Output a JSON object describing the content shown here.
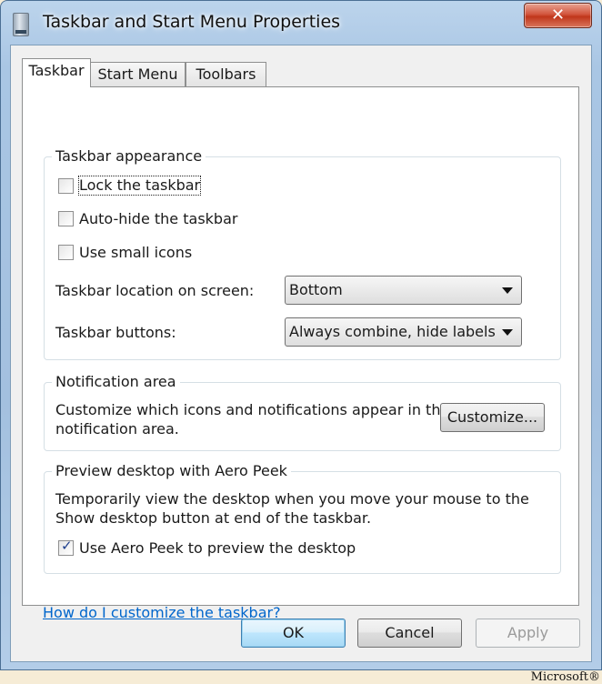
{
  "window": {
    "title": "Taskbar and Start Menu Properties",
    "close_glyph": "✕"
  },
  "tabs": [
    {
      "label": "Taskbar",
      "active": true
    },
    {
      "label": "Start Menu",
      "active": false
    },
    {
      "label": "Toolbars",
      "active": false
    }
  ],
  "taskbar_appearance": {
    "title": "Taskbar appearance",
    "lock_taskbar": {
      "label": "Lock the taskbar",
      "checked": false
    },
    "auto_hide": {
      "label": "Auto-hide the taskbar",
      "checked": false
    },
    "small_icons": {
      "label": "Use small icons",
      "checked": false
    },
    "location_label": "Taskbar location on screen:",
    "location_value": "Bottom",
    "buttons_label": "Taskbar buttons:",
    "buttons_value": "Always combine, hide labels"
  },
  "notification_area": {
    "title": "Notification area",
    "description_line1": "Customize which icons and notifications appear in the",
    "description_line2": "notification area.",
    "customize_label": "Customize..."
  },
  "aero_peek": {
    "title": "Preview desktop with Aero Peek",
    "description_line1": "Temporarily view the desktop when you move your mouse to the",
    "description_line2": "Show desktop button at end of the taskbar.",
    "use_peek": {
      "label": "Use Aero Peek to preview the desktop",
      "checked": true
    }
  },
  "help_link": "How do I customize the taskbar?",
  "buttons": {
    "ok": "OK",
    "cancel": "Cancel",
    "apply": "Apply"
  },
  "credit": "Microsoft®",
  "icons": {
    "checkmark": "✓",
    "app": "taskbar-app-icon",
    "dropdown": "chevron-down-icon"
  }
}
